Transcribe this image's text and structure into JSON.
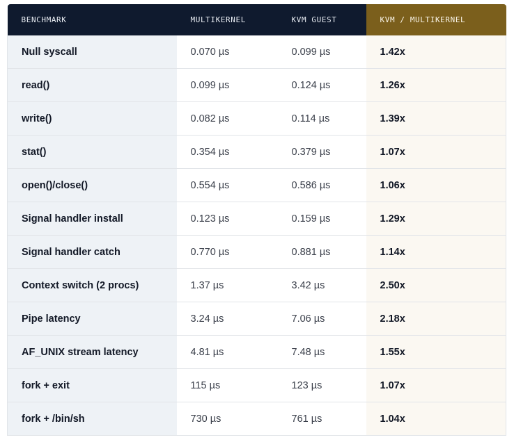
{
  "columns": {
    "benchmark": "BENCHMARK",
    "multikernel": "MULTIKERNEL",
    "kvm_guest": "KVM GUEST",
    "ratio": "KVM / MULTIKERNEL"
  },
  "colors": {
    "header_bg": "#0f1a2e",
    "highlight_header_bg": "#7b5f1c",
    "benchmark_col_bg": "#eef2f6",
    "ratio_col_bg": "#fbf8f2"
  },
  "rows": [
    {
      "benchmark": "Null syscall",
      "multikernel": "0.070 µs",
      "kvm_guest": "0.099 µs",
      "ratio": "1.42x"
    },
    {
      "benchmark": "read()",
      "multikernel": "0.099 µs",
      "kvm_guest": "0.124 µs",
      "ratio": "1.26x"
    },
    {
      "benchmark": "write()",
      "multikernel": "0.082 µs",
      "kvm_guest": "0.114 µs",
      "ratio": "1.39x"
    },
    {
      "benchmark": "stat()",
      "multikernel": "0.354 µs",
      "kvm_guest": "0.379 µs",
      "ratio": "1.07x"
    },
    {
      "benchmark": "open()/close()",
      "multikernel": "0.554 µs",
      "kvm_guest": "0.586 µs",
      "ratio": "1.06x"
    },
    {
      "benchmark": "Signal handler install",
      "multikernel": "0.123 µs",
      "kvm_guest": "0.159 µs",
      "ratio": "1.29x"
    },
    {
      "benchmark": "Signal handler catch",
      "multikernel": "0.770 µs",
      "kvm_guest": "0.881 µs",
      "ratio": "1.14x"
    },
    {
      "benchmark": "Context switch (2 procs)",
      "multikernel": "1.37 µs",
      "kvm_guest": "3.42 µs",
      "ratio": "2.50x"
    },
    {
      "benchmark": "Pipe latency",
      "multikernel": "3.24 µs",
      "kvm_guest": "7.06 µs",
      "ratio": "2.18x"
    },
    {
      "benchmark": "AF_UNIX stream latency",
      "multikernel": "4.81 µs",
      "kvm_guest": "7.48 µs",
      "ratio": "1.55x"
    },
    {
      "benchmark": "fork + exit",
      "multikernel": "115 µs",
      "kvm_guest": "123 µs",
      "ratio": "1.07x"
    },
    {
      "benchmark": "fork + /bin/sh",
      "multikernel": "730 µs",
      "kvm_guest": "761 µs",
      "ratio": "1.04x"
    }
  ]
}
